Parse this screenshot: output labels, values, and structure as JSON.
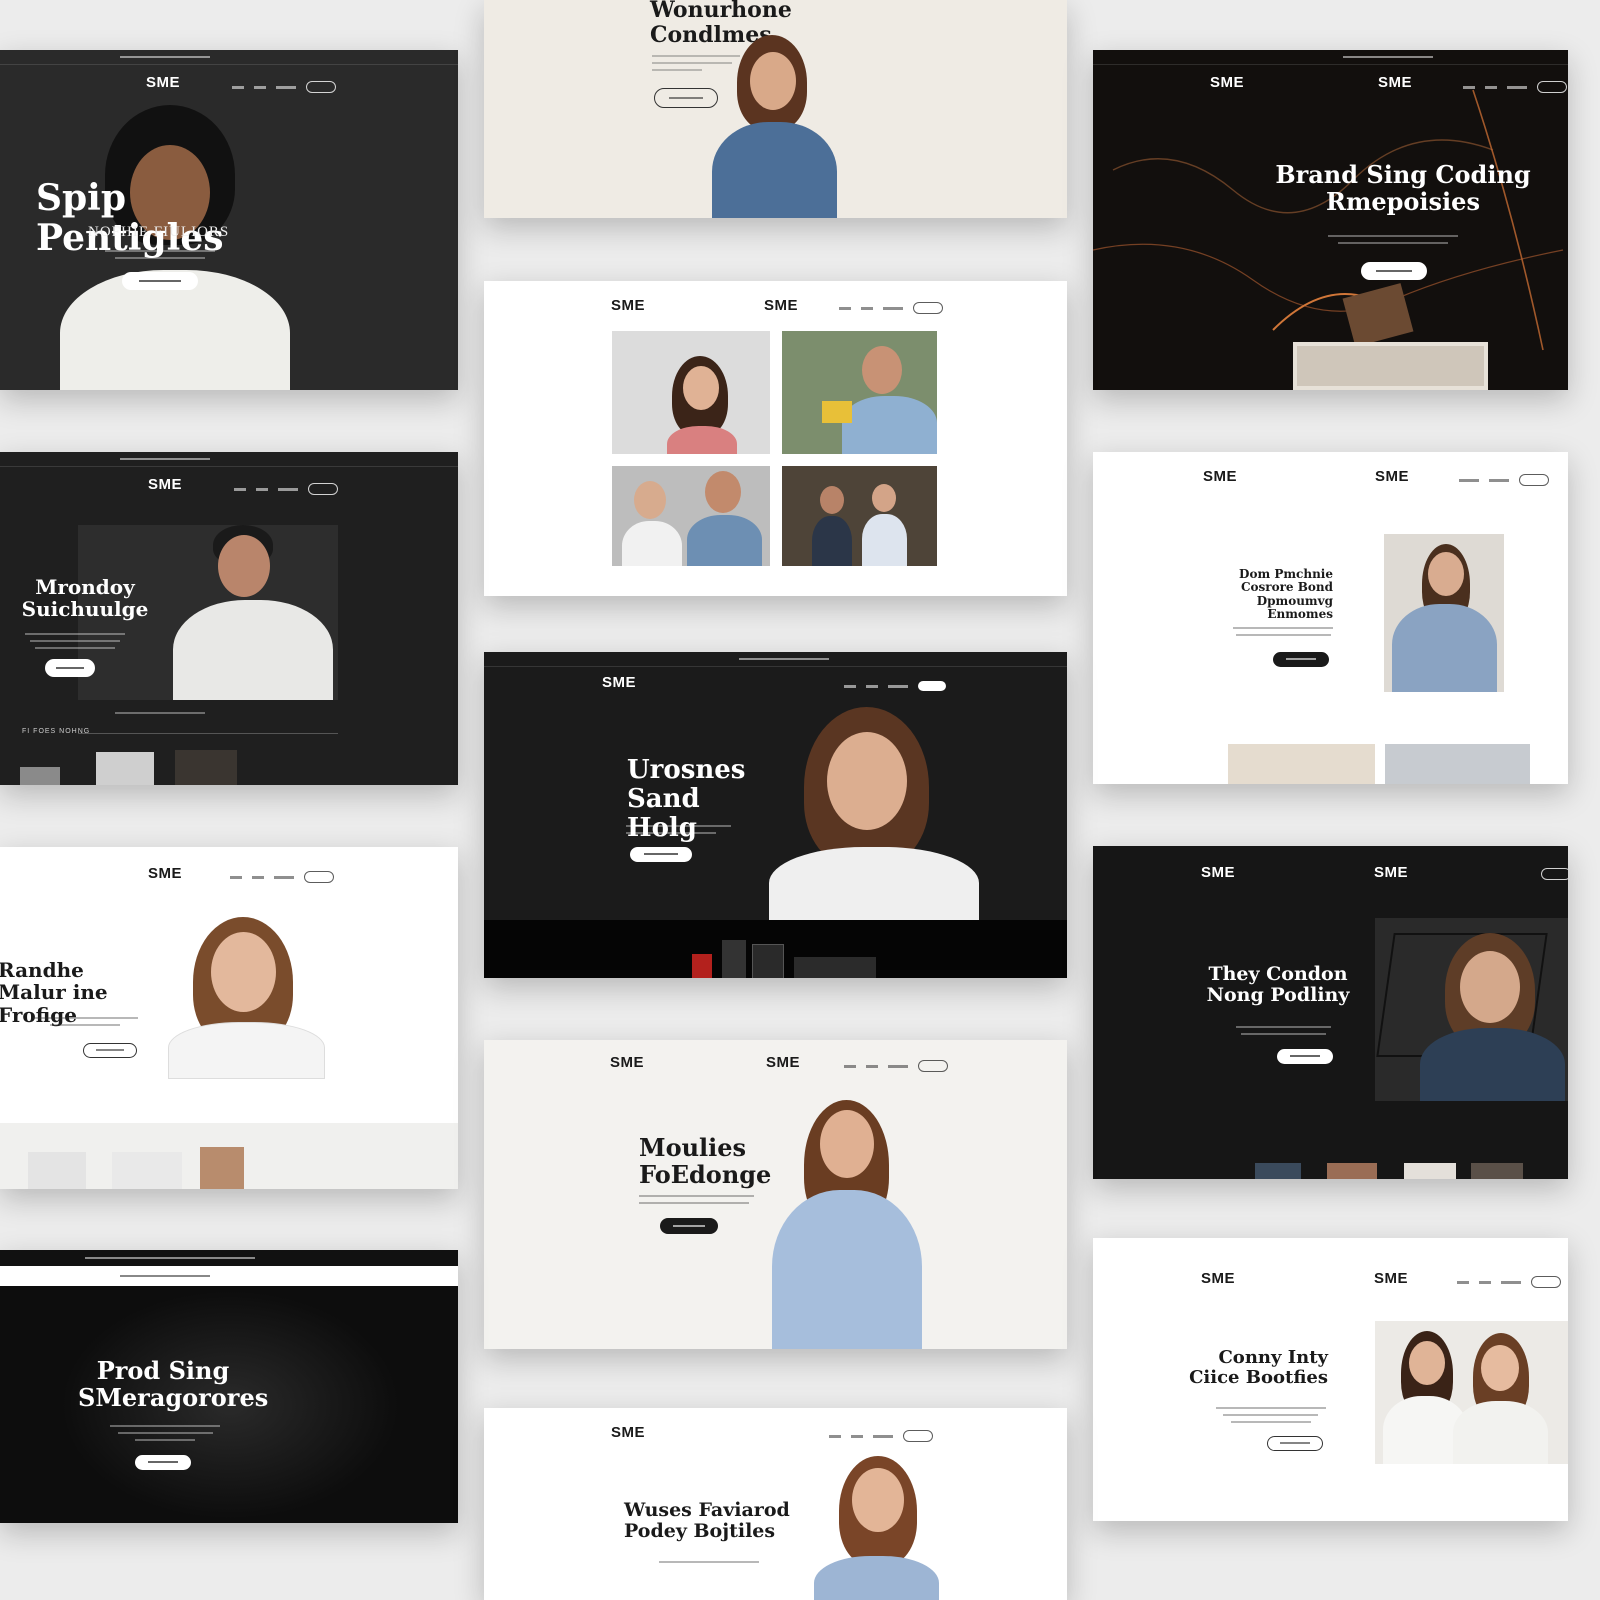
{
  "brand": "SME",
  "cards": {
    "c1": {
      "headline": "Spip Pentigles",
      "subline": "NOFHIE FIULIORS"
    },
    "c2": {
      "headline": "Wonurhone Condlmes"
    },
    "c3": {
      "headline": "Brand Sing Coding Rmepoisies"
    },
    "c4": {},
    "c5": {
      "headline": "Mrondoy Suichuulge",
      "section_label": "FI FOES NOHNG"
    },
    "c6": {
      "headline": "Dom Pmchnie Cosrore Bond Dpmoumvg Enmomes"
    },
    "c7": {
      "headline": "Urosnes Sand Holg"
    },
    "c8": {
      "headline": "Randhe Malur ine Frofige"
    },
    "c9": {
      "headline": "They Condon Nong Podliny"
    },
    "c10": {
      "headline": "Moulies FoEdonge"
    },
    "c11": {
      "headline": "Prod Sing SMeragorores"
    },
    "c12": {
      "headline": "Conny Inty Ciice Bootfies"
    },
    "c13": {
      "headline": "Wuses Faviarod Podey Bojtiles"
    }
  },
  "colors": {
    "dark_bg": "#1c1c1c",
    "light_bg": "#ffffff",
    "cream_bg": "#efebe4",
    "page_bg": "#ececec"
  },
  "icons": [
    "menu-pill-icon"
  ]
}
